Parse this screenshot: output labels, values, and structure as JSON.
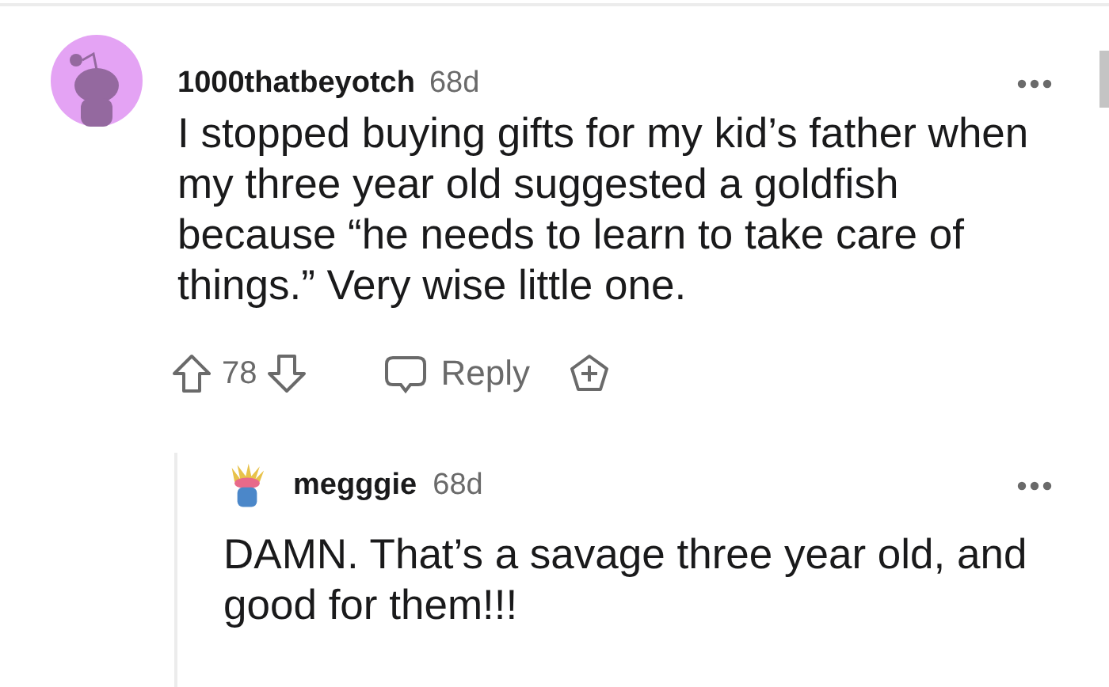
{
  "comment": {
    "username": "1000thatbeyotch",
    "age": "68d",
    "body": "I stopped buying gifts for my kid’s father when my three year old suggested a goldfish because “he needs to learn to take care of things.” Very wise little one.",
    "score": "78",
    "reply_label": "Reply"
  },
  "reply": {
    "username": "megggie",
    "age": "68d",
    "body": "DAMN. That’s a savage three year old, and good for them!!!"
  }
}
